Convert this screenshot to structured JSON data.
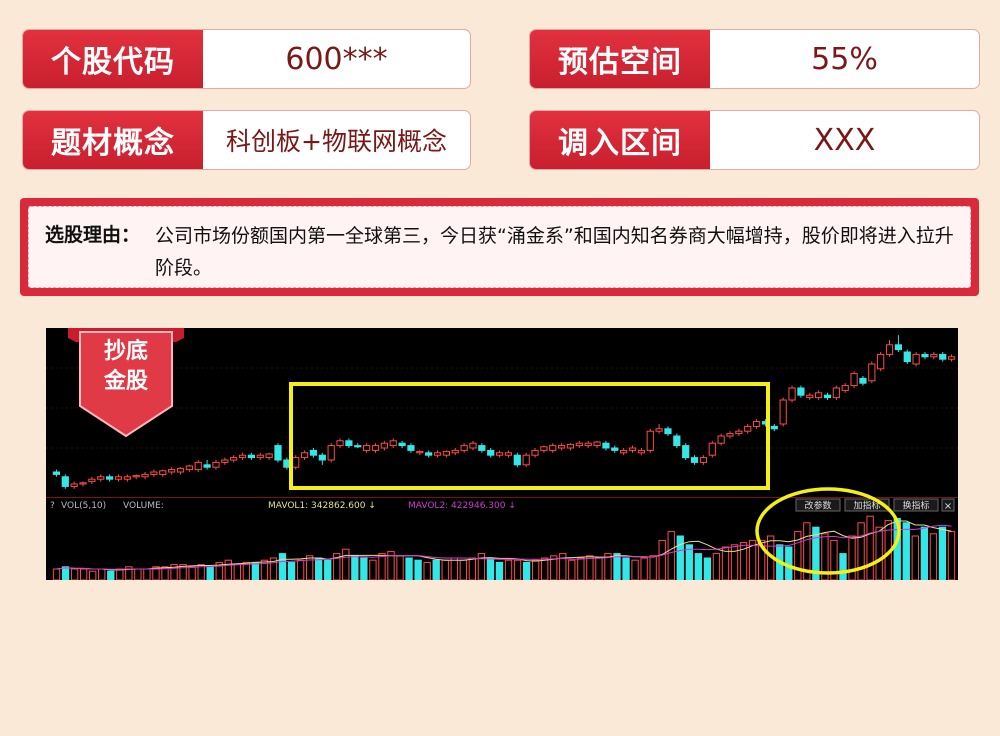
{
  "fields": {
    "stock_code_label": "个股代码",
    "stock_code_value": "600***",
    "expected_space_label": "预估空间",
    "expected_space_value": "55%",
    "concept_label": "题材概念",
    "concept_value": "科创板+物联网概念",
    "entry_range_label": "调入区间",
    "entry_range_value": "XXX"
  },
  "reason": {
    "title": "选股理由：",
    "text": "公司市场份额国内第一全球第三，今日获“涌金系”和国内知名券商大幅增持，股价即将进入拉升阶段。"
  },
  "badge": {
    "line1": "抄底",
    "line2": "金股"
  },
  "chart_data": {
    "type": "candlestick+volume",
    "volume_header": {
      "indicator": "VOL(5,10)",
      "name": "VOLUME:",
      "mavol1_label": "MAVOL1: 342862.600",
      "mavol2_label": "MAVOL2: 422946.300"
    },
    "buttons": [
      "改参数",
      "加指标",
      "换指标"
    ],
    "close_button": "×",
    "candles": [
      {
        "o": 55,
        "c": 54,
        "h": 56,
        "l": 53
      },
      {
        "o": 53,
        "c": 49,
        "h": 54,
        "l": 48
      },
      {
        "o": 49,
        "c": 50,
        "h": 51,
        "l": 48
      },
      {
        "o": 50,
        "c": 50.5,
        "h": 51,
        "l": 49
      },
      {
        "o": 51,
        "c": 52,
        "h": 53,
        "l": 50
      },
      {
        "o": 52,
        "c": 53,
        "h": 54,
        "l": 51
      },
      {
        "o": 53,
        "c": 52,
        "h": 54,
        "l": 51
      },
      {
        "o": 52,
        "c": 53,
        "h": 54,
        "l": 51
      },
      {
        "o": 52,
        "c": 53,
        "h": 54,
        "l": 51
      },
      {
        "o": 53,
        "c": 53.5,
        "h": 54,
        "l": 52
      },
      {
        "o": 53,
        "c": 54,
        "h": 55,
        "l": 52
      },
      {
        "o": 54,
        "c": 55,
        "h": 56,
        "l": 53
      },
      {
        "o": 54,
        "c": 55.5,
        "h": 56,
        "l": 53
      },
      {
        "o": 55,
        "c": 56,
        "h": 57,
        "l": 54
      },
      {
        "o": 55,
        "c": 56.5,
        "h": 57,
        "l": 54
      },
      {
        "o": 56,
        "c": 57.5,
        "h": 58,
        "l": 55
      },
      {
        "o": 56,
        "c": 59,
        "h": 60,
        "l": 55
      },
      {
        "o": 58,
        "c": 57,
        "h": 60,
        "l": 56
      },
      {
        "o": 57,
        "c": 59,
        "h": 60,
        "l": 56
      },
      {
        "o": 59,
        "c": 60,
        "h": 61,
        "l": 58
      },
      {
        "o": 60,
        "c": 61,
        "h": 62,
        "l": 59
      },
      {
        "o": 61,
        "c": 62,
        "h": 63,
        "l": 60
      },
      {
        "o": 62,
        "c": 61,
        "h": 63,
        "l": 60
      },
      {
        "o": 61,
        "c": 62,
        "h": 63,
        "l": 60
      },
      {
        "o": 61,
        "c": 62.5,
        "h": 63,
        "l": 60
      },
      {
        "o": 66,
        "c": 60,
        "h": 67,
        "l": 59
      },
      {
        "o": 60,
        "c": 57,
        "h": 61,
        "l": 56
      },
      {
        "o": 57,
        "c": 61,
        "h": 62,
        "l": 56
      },
      {
        "o": 61,
        "c": 63,
        "h": 64,
        "l": 60
      },
      {
        "o": 64,
        "c": 62,
        "h": 65,
        "l": 61
      },
      {
        "o": 62,
        "c": 60,
        "h": 63,
        "l": 58
      },
      {
        "o": 60,
        "c": 66,
        "h": 67,
        "l": 59
      },
      {
        "o": 66,
        "c": 68,
        "h": 69,
        "l": 65
      },
      {
        "o": 68,
        "c": 66,
        "h": 69,
        "l": 65
      },
      {
        "o": 66,
        "c": 65.5,
        "h": 67,
        "l": 65
      },
      {
        "o": 64,
        "c": 66,
        "h": 67,
        "l": 63
      },
      {
        "o": 64,
        "c": 66,
        "h": 67,
        "l": 63
      },
      {
        "o": 65,
        "c": 67,
        "h": 68,
        "l": 64
      },
      {
        "o": 66,
        "c": 68,
        "h": 69,
        "l": 65
      },
      {
        "o": 67,
        "c": 66,
        "h": 68,
        "l": 65
      },
      {
        "o": 66,
        "c": 64,
        "h": 67,
        "l": 63
      },
      {
        "o": 63,
        "c": 63.5,
        "h": 64,
        "l": 62
      },
      {
        "o": 63,
        "c": 62,
        "h": 64,
        "l": 61
      },
      {
        "o": 62,
        "c": 63,
        "h": 64,
        "l": 61
      },
      {
        "o": 62,
        "c": 63.5,
        "h": 64,
        "l": 61
      },
      {
        "o": 63,
        "c": 64,
        "h": 65,
        "l": 62
      },
      {
        "o": 64,
        "c": 66,
        "h": 67,
        "l": 63
      },
      {
        "o": 65,
        "c": 67,
        "h": 68,
        "l": 64
      },
      {
        "o": 66,
        "c": 64,
        "h": 67,
        "l": 63
      },
      {
        "o": 64,
        "c": 62,
        "h": 65,
        "l": 61
      },
      {
        "o": 62,
        "c": 63,
        "h": 64,
        "l": 61
      },
      {
        "o": 62,
        "c": 63,
        "h": 64,
        "l": 61
      },
      {
        "o": 62,
        "c": 58,
        "h": 63,
        "l": 57
      },
      {
        "o": 58,
        "c": 62,
        "h": 63,
        "l": 57
      },
      {
        "o": 62,
        "c": 64,
        "h": 65,
        "l": 61
      },
      {
        "o": 64,
        "c": 65.5,
        "h": 66,
        "l": 63
      },
      {
        "o": 64,
        "c": 66,
        "h": 67,
        "l": 63
      },
      {
        "o": 65,
        "c": 66,
        "h": 67,
        "l": 64
      },
      {
        "o": 65,
        "c": 66.5,
        "h": 67,
        "l": 64
      },
      {
        "o": 66,
        "c": 67,
        "h": 68,
        "l": 65
      },
      {
        "o": 66,
        "c": 67,
        "h": 68,
        "l": 65
      },
      {
        "o": 66,
        "c": 67.5,
        "h": 68,
        "l": 65
      },
      {
        "o": 67,
        "c": 65,
        "h": 68,
        "l": 64
      },
      {
        "o": 65,
        "c": 64,
        "h": 66,
        "l": 63
      },
      {
        "o": 63,
        "c": 64,
        "h": 65,
        "l": 62
      },
      {
        "o": 64,
        "c": 65,
        "h": 66,
        "l": 63
      },
      {
        "o": 63,
        "c": 64,
        "h": 65,
        "l": 62
      },
      {
        "o": 64,
        "c": 72,
        "h": 73,
        "l": 63
      },
      {
        "o": 72,
        "c": 73,
        "h": 75,
        "l": 71
      },
      {
        "o": 73,
        "c": 71,
        "h": 74,
        "l": 70
      },
      {
        "o": 70,
        "c": 66,
        "h": 71,
        "l": 65
      },
      {
        "o": 66,
        "c": 61,
        "h": 67,
        "l": 60
      },
      {
        "o": 61,
        "c": 59,
        "h": 62,
        "l": 58
      },
      {
        "o": 59,
        "c": 61,
        "h": 62,
        "l": 58
      },
      {
        "o": 62,
        "c": 67,
        "h": 68,
        "l": 61
      },
      {
        "o": 67,
        "c": 70,
        "h": 71,
        "l": 66
      },
      {
        "o": 70,
        "c": 71,
        "h": 72,
        "l": 69
      },
      {
        "o": 71,
        "c": 72,
        "h": 73,
        "l": 70
      },
      {
        "o": 72,
        "c": 74,
        "h": 75,
        "l": 71
      },
      {
        "o": 74,
        "c": 76,
        "h": 77,
        "l": 73
      },
      {
        "o": 76,
        "c": 75,
        "h": 77,
        "l": 74
      },
      {
        "o": 74,
        "c": 73,
        "h": 75,
        "l": 72
      },
      {
        "o": 75,
        "c": 85,
        "h": 86,
        "l": 74
      },
      {
        "o": 85,
        "c": 90,
        "h": 91,
        "l": 84
      },
      {
        "o": 90,
        "c": 87,
        "h": 91,
        "l": 86
      },
      {
        "o": 86,
        "c": 87,
        "h": 88,
        "l": 85
      },
      {
        "o": 86,
        "c": 88,
        "h": 89,
        "l": 85
      },
      {
        "o": 87,
        "c": 86,
        "h": 88,
        "l": 85
      },
      {
        "o": 86,
        "c": 90,
        "h": 91,
        "l": 85
      },
      {
        "o": 89,
        "c": 91,
        "h": 92,
        "l": 88
      },
      {
        "o": 91,
        "c": 96,
        "h": 97,
        "l": 90
      },
      {
        "o": 94,
        "c": 92,
        "h": 95,
        "l": 91
      },
      {
        "o": 93,
        "c": 100,
        "h": 101,
        "l": 92
      },
      {
        "o": 98,
        "c": 104,
        "h": 105,
        "l": 97
      },
      {
        "o": 104,
        "c": 108,
        "h": 110,
        "l": 103
      },
      {
        "o": 108,
        "c": 106,
        "h": 112,
        "l": 105
      },
      {
        "o": 105,
        "c": 101,
        "h": 106,
        "l": 100
      },
      {
        "o": 100,
        "c": 104,
        "h": 105,
        "l": 99
      },
      {
        "o": 104,
        "c": 103,
        "h": 105,
        "l": 102
      },
      {
        "o": 103,
        "c": 104,
        "h": 105,
        "l": 102
      },
      {
        "o": 104,
        "c": 102,
        "h": 105,
        "l": 101
      },
      {
        "o": 102,
        "c": 103,
        "h": 104,
        "l": 101
      }
    ],
    "volume": [
      5,
      6,
      5,
      5,
      4,
      5,
      4,
      5,
      6,
      5,
      5,
      6,
      6,
      7,
      7,
      6,
      7,
      6,
      8,
      9,
      7,
      8,
      8,
      9,
      10,
      12,
      8,
      9,
      11,
      10,
      9,
      12,
      14,
      11,
      10,
      9,
      12,
      13,
      11,
      10,
      9,
      8,
      9,
      9,
      10,
      9,
      10,
      12,
      10,
      8,
      9,
      9,
      8,
      9,
      10,
      11,
      12,
      9,
      10,
      11,
      10,
      12,
      12,
      10,
      9,
      10,
      11,
      18,
      22,
      20,
      16,
      12,
      10,
      12,
      15,
      16,
      17,
      18,
      18,
      20,
      16,
      15,
      22,
      26,
      24,
      21,
      18,
      12,
      20,
      26,
      29,
      24,
      27,
      28,
      26,
      20,
      24,
      21,
      24,
      22
    ],
    "volume_up": [
      1,
      0,
      1,
      1,
      1,
      1,
      0,
      1,
      1,
      1,
      1,
      1,
      1,
      1,
      1,
      1,
      1,
      0,
      1,
      1,
      1,
      1,
      0,
      1,
      1,
      0,
      0,
      1,
      1,
      0,
      0,
      1,
      1,
      0,
      0,
      1,
      1,
      1,
      1,
      0,
      0,
      1,
      0,
      1,
      1,
      1,
      1,
      1,
      0,
      0,
      1,
      1,
      0,
      1,
      1,
      1,
      1,
      1,
      1,
      1,
      1,
      1,
      0,
      0,
      1,
      1,
      1,
      1,
      1,
      0,
      0,
      0,
      0,
      1,
      1,
      1,
      1,
      1,
      1,
      1,
      0,
      0,
      1,
      1,
      0,
      1,
      1,
      0,
      1,
      1,
      1,
      1,
      1,
      0,
      0,
      1,
      0,
      1,
      0,
      1
    ]
  },
  "colors": {
    "up": "#ff4a4a",
    "down": "#34e6e6",
    "highlight": "#f4f016",
    "mavol1": "#e5e08a",
    "mavol2": "#d03bd6"
  }
}
